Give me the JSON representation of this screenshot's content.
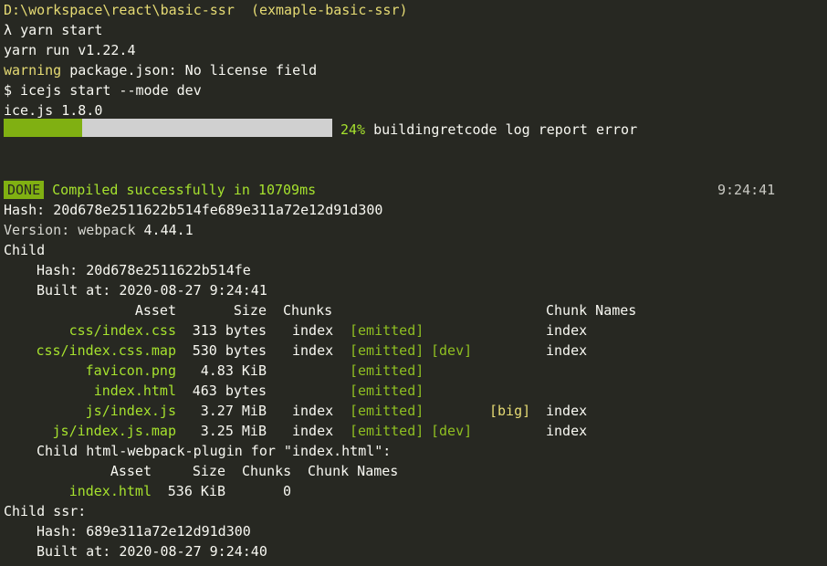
{
  "prompt": {
    "path": "D:\\workspace\\react\\basic-ssr",
    "branch": "(exmaple-basic-ssr)",
    "symbol": "λ",
    "command": "yarn start"
  },
  "yarn_version": "yarn run v1.22.4",
  "warning": {
    "label": "warning",
    "text": "package.json: No license field"
  },
  "exec_line": "$ icejs start --mode dev",
  "ice_version": "ice.js 1.8.0",
  "progress": {
    "percent": 24,
    "percent_label": "24%",
    "status": "buildingretcode log report error"
  },
  "done": {
    "badge": "DONE",
    "message": "Compiled successfully in 10709ms",
    "time": "9:24:41"
  },
  "build": {
    "hash_label": "Hash:",
    "hash": "20d678e2511622b514fe689e311a72e12d91d300",
    "version_label": "Version: webpack",
    "version": "4.44.1",
    "child_label": "Child",
    "child": {
      "hash_label": "Hash:",
      "hash": "20d678e2511622b514fe",
      "built_label": "Built at:",
      "built_date": "2020-08-27",
      "built_time": "9:24:41"
    }
  },
  "asset_table": {
    "headers": [
      "Asset",
      "Size",
      "Chunks",
      "Chunk Names"
    ],
    "rows": [
      {
        "asset": "css/index.css",
        "size": "313 bytes",
        "chunks": "index",
        "status": "[emitted]",
        "dev": "",
        "big": "",
        "names": "index"
      },
      {
        "asset": "css/index.css.map",
        "size": "530 bytes",
        "chunks": "index",
        "status": "[emitted]",
        "dev": "[dev]",
        "big": "",
        "names": "index"
      },
      {
        "asset": "favicon.png",
        "size": "4.83 KiB",
        "chunks": "",
        "status": "[emitted]",
        "dev": "",
        "big": "",
        "names": ""
      },
      {
        "asset": "index.html",
        "size": "463 bytes",
        "chunks": "",
        "status": "[emitted]",
        "dev": "",
        "big": "",
        "names": ""
      },
      {
        "asset": "js/index.js",
        "size": "3.27 MiB",
        "chunks": "index",
        "status": "[emitted]",
        "dev": "",
        "big": "[big]",
        "names": "index"
      },
      {
        "asset": "js/index.js.map",
        "size": "3.25 MiB",
        "chunks": "index",
        "status": "[emitted]",
        "dev": "[dev]",
        "big": "",
        "names": "index"
      }
    ]
  },
  "child_plugin": {
    "title_label": "Child",
    "title": "html-webpack-plugin for \"index.html\":",
    "headers": [
      "Asset",
      "Size",
      "Chunks",
      "Chunk Names"
    ],
    "row": {
      "asset": "index.html",
      "size": "536 KiB",
      "chunks": "0"
    }
  },
  "child_ssr": {
    "title": "Child ssr:",
    "hash_label": "Hash:",
    "hash": "689e311a72e12d91d300",
    "built_label": "Built at:",
    "built_date": "2020-08-27",
    "built_time": "9:24:40"
  },
  "colors": {
    "background": "#272822",
    "foreground": "#f8f8f2",
    "accent_green": "#a6e22e",
    "warning_yellow": "#e6db74",
    "progress_fill": "#80b012",
    "progress_track": "#d0d0d0"
  }
}
